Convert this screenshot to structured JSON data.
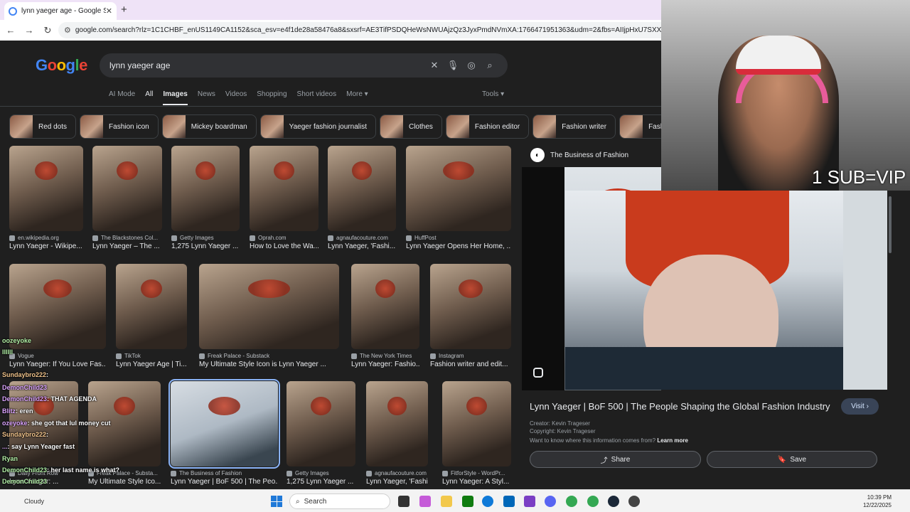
{
  "tab": {
    "title": "lynn yaeger age - Google Search",
    "close": "✕",
    "new_tab": "+"
  },
  "toolbar": {
    "back": "←",
    "forward": "→",
    "reload": "↻",
    "url": "google.com/search?rlz=1C1CHBF_enUS1149CA1152&sca_esv=e4f1de28a58476a8&sxsrf=AE3TifPSDQHeWsNWUAjzQz3JyxPmdNVmXA:1766471951363&udm=2&fbs=AIIjpHxU7SXXniUZfeShr2fp4giZ1Y"
  },
  "google": {
    "logo": [
      "G",
      "o",
      "o",
      "g",
      "l",
      "e"
    ],
    "query": "lynn yaeger age",
    "tabs": [
      "AI Mode",
      "All",
      "Images",
      "News",
      "Videos",
      "Shopping",
      "Short videos",
      "More ▾"
    ],
    "tools": "Tools ▾"
  },
  "chips": [
    "Red dots",
    "Fashion icon",
    "Mickey boardman",
    "Yaeger fashion journalist",
    "Clothes",
    "Fashion editor",
    "Fashion writer",
    "Fashion des"
  ],
  "results": [
    {
      "source": "en.wikipedia.org",
      "caption": "Lynn Yaeger - Wikipe..."
    },
    {
      "source": "The Blackstones Col...",
      "caption": "Lynn Yaeger – The ..."
    },
    {
      "source": "Getty Images",
      "caption": "1,275 Lynn Yaeger ..."
    },
    {
      "source": "Oprah.com",
      "caption": "How to Love the Wa..."
    },
    {
      "source": "agnaufacouture.com",
      "caption": "Lynn Yaeger, 'Fashi..."
    },
    {
      "source": "HuffPost",
      "caption": "Lynn Yaeger Opens Her Home, ..."
    },
    {
      "source": "Vogue",
      "caption": "Lynn Yaeger: If You Love Fas..."
    },
    {
      "source": "TikTok",
      "caption": "Lynn Yaeger Age | Ti..."
    },
    {
      "source": "Freak Palace - Substack",
      "caption": "My Ultimate Style Icon is Lynn Yaeger ..."
    },
    {
      "source": "The New York Times",
      "caption": "Lynn Yaeger: Fashio..."
    },
    {
      "source": "Instagram",
      "caption": "Fashion writer and edit..."
    },
    {
      "source": "Daily Front Row",
      "caption": "Lynn Yaeger: ..."
    },
    {
      "source": "Freak Palace - Substa...",
      "caption": "My Ultimate Style Ico..."
    },
    {
      "source": "The Business of Fashion",
      "caption": "Lynn Yaeger | BoF 500 | The Peo..."
    },
    {
      "source": "Getty Images",
      "caption": "1,275 Lynn Yaeger ..."
    },
    {
      "source": "agnaufacouture.com",
      "caption": "Lynn Yaeger, 'Fashi..."
    },
    {
      "source": "FitforStyle - WordPr...",
      "caption": "Lynn Yaeger: A Styl..."
    }
  ],
  "panel": {
    "source": "The Business of Fashion",
    "title": "Lynn Yaeger | BoF 500 | The People Shaping the Global Fashion Industry",
    "visit": "Visit ›",
    "creator": "Creator: Kevin Trageser",
    "copyright": "Copyright: Kevin Trageser",
    "info": "Want to know where this information comes from?",
    "learn_more": "Learn more",
    "share": "Share",
    "save": "Save"
  },
  "stream": {
    "sub_text": "1 SUB=VIP"
  },
  "chat": [
    {
      "user": "",
      "text": "oozeyoke"
    },
    {
      "user": "IIIIII",
      "text": ""
    },
    {
      "user": "Sundaybro222",
      "text": ":"
    },
    {
      "user": "DemonChild23",
      "text": ""
    },
    {
      "user": "DemonChild23",
      "text": ": THAT AGENDA"
    },
    {
      "user": "Blitz",
      "text": ": eren"
    },
    {
      "user": "ozeyoke",
      "text": ": she got that lul money cut"
    },
    {
      "user": "Sundaybro222",
      "text": ":"
    },
    {
      "user": "...",
      "text": ": say Lynn Yeager fast"
    },
    {
      "user": "Ryan",
      "text": ""
    },
    {
      "user": "DemonChild23",
      "text": ": her last name is what?"
    },
    {
      "user": "DemonChild23",
      "text": ""
    }
  ],
  "taskbar": {
    "weather": "Cloudy",
    "search": "Search",
    "time": "10:39 PM",
    "date": "12/22/2025",
    "badge": "13"
  },
  "colors": {
    "accent_blue": "#8ab4f8",
    "page_bg": "#1f1f1f",
    "chrome_tab_strip": "#efe3f7"
  }
}
